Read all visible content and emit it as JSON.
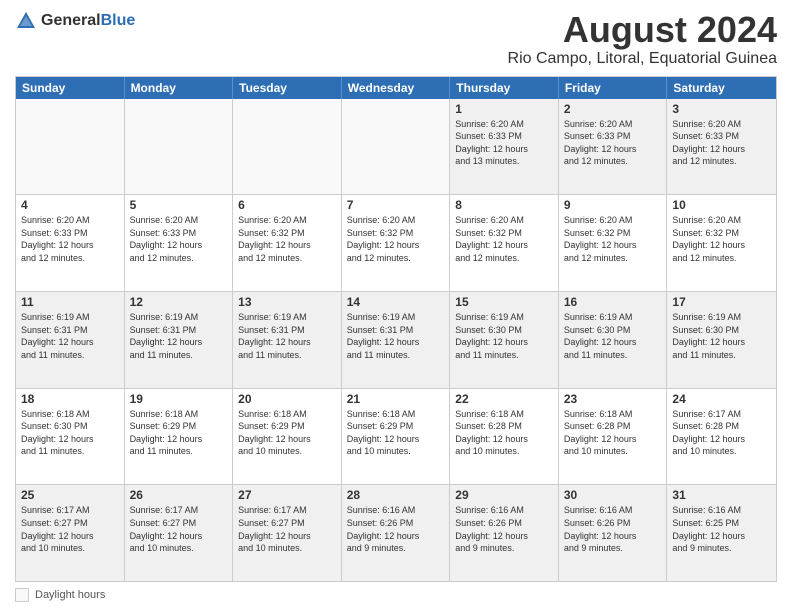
{
  "logo": {
    "general": "General",
    "blue": "Blue"
  },
  "title": "August 2024",
  "subtitle": "Rio Campo, Litoral, Equatorial Guinea",
  "days": [
    "Sunday",
    "Monday",
    "Tuesday",
    "Wednesday",
    "Thursday",
    "Friday",
    "Saturday"
  ],
  "weeks": [
    [
      {
        "day": "",
        "info": ""
      },
      {
        "day": "",
        "info": ""
      },
      {
        "day": "",
        "info": ""
      },
      {
        "day": "",
        "info": ""
      },
      {
        "day": "1",
        "info": "Sunrise: 6:20 AM\nSunset: 6:33 PM\nDaylight: 12 hours\nand 13 minutes."
      },
      {
        "day": "2",
        "info": "Sunrise: 6:20 AM\nSunset: 6:33 PM\nDaylight: 12 hours\nand 12 minutes."
      },
      {
        "day": "3",
        "info": "Sunrise: 6:20 AM\nSunset: 6:33 PM\nDaylight: 12 hours\nand 12 minutes."
      }
    ],
    [
      {
        "day": "4",
        "info": "Sunrise: 6:20 AM\nSunset: 6:33 PM\nDaylight: 12 hours\nand 12 minutes."
      },
      {
        "day": "5",
        "info": "Sunrise: 6:20 AM\nSunset: 6:33 PM\nDaylight: 12 hours\nand 12 minutes."
      },
      {
        "day": "6",
        "info": "Sunrise: 6:20 AM\nSunset: 6:32 PM\nDaylight: 12 hours\nand 12 minutes."
      },
      {
        "day": "7",
        "info": "Sunrise: 6:20 AM\nSunset: 6:32 PM\nDaylight: 12 hours\nand 12 minutes."
      },
      {
        "day": "8",
        "info": "Sunrise: 6:20 AM\nSunset: 6:32 PM\nDaylight: 12 hours\nand 12 minutes."
      },
      {
        "day": "9",
        "info": "Sunrise: 6:20 AM\nSunset: 6:32 PM\nDaylight: 12 hours\nand 12 minutes."
      },
      {
        "day": "10",
        "info": "Sunrise: 6:20 AM\nSunset: 6:32 PM\nDaylight: 12 hours\nand 12 minutes."
      }
    ],
    [
      {
        "day": "11",
        "info": "Sunrise: 6:19 AM\nSunset: 6:31 PM\nDaylight: 12 hours\nand 11 minutes."
      },
      {
        "day": "12",
        "info": "Sunrise: 6:19 AM\nSunset: 6:31 PM\nDaylight: 12 hours\nand 11 minutes."
      },
      {
        "day": "13",
        "info": "Sunrise: 6:19 AM\nSunset: 6:31 PM\nDaylight: 12 hours\nand 11 minutes."
      },
      {
        "day": "14",
        "info": "Sunrise: 6:19 AM\nSunset: 6:31 PM\nDaylight: 12 hours\nand 11 minutes."
      },
      {
        "day": "15",
        "info": "Sunrise: 6:19 AM\nSunset: 6:30 PM\nDaylight: 12 hours\nand 11 minutes."
      },
      {
        "day": "16",
        "info": "Sunrise: 6:19 AM\nSunset: 6:30 PM\nDaylight: 12 hours\nand 11 minutes."
      },
      {
        "day": "17",
        "info": "Sunrise: 6:19 AM\nSunset: 6:30 PM\nDaylight: 12 hours\nand 11 minutes."
      }
    ],
    [
      {
        "day": "18",
        "info": "Sunrise: 6:18 AM\nSunset: 6:30 PM\nDaylight: 12 hours\nand 11 minutes."
      },
      {
        "day": "19",
        "info": "Sunrise: 6:18 AM\nSunset: 6:29 PM\nDaylight: 12 hours\nand 11 minutes."
      },
      {
        "day": "20",
        "info": "Sunrise: 6:18 AM\nSunset: 6:29 PM\nDaylight: 12 hours\nand 10 minutes."
      },
      {
        "day": "21",
        "info": "Sunrise: 6:18 AM\nSunset: 6:29 PM\nDaylight: 12 hours\nand 10 minutes."
      },
      {
        "day": "22",
        "info": "Sunrise: 6:18 AM\nSunset: 6:28 PM\nDaylight: 12 hours\nand 10 minutes."
      },
      {
        "day": "23",
        "info": "Sunrise: 6:18 AM\nSunset: 6:28 PM\nDaylight: 12 hours\nand 10 minutes."
      },
      {
        "day": "24",
        "info": "Sunrise: 6:17 AM\nSunset: 6:28 PM\nDaylight: 12 hours\nand 10 minutes."
      }
    ],
    [
      {
        "day": "25",
        "info": "Sunrise: 6:17 AM\nSunset: 6:27 PM\nDaylight: 12 hours\nand 10 minutes."
      },
      {
        "day": "26",
        "info": "Sunrise: 6:17 AM\nSunset: 6:27 PM\nDaylight: 12 hours\nand 10 minutes."
      },
      {
        "day": "27",
        "info": "Sunrise: 6:17 AM\nSunset: 6:27 PM\nDaylight: 12 hours\nand 10 minutes."
      },
      {
        "day": "28",
        "info": "Sunrise: 6:16 AM\nSunset: 6:26 PM\nDaylight: 12 hours\nand 9 minutes."
      },
      {
        "day": "29",
        "info": "Sunrise: 6:16 AM\nSunset: 6:26 PM\nDaylight: 12 hours\nand 9 minutes."
      },
      {
        "day": "30",
        "info": "Sunrise: 6:16 AM\nSunset: 6:26 PM\nDaylight: 12 hours\nand 9 minutes."
      },
      {
        "day": "31",
        "info": "Sunrise: 6:16 AM\nSunset: 6:25 PM\nDaylight: 12 hours\nand 9 minutes."
      }
    ]
  ],
  "footer": {
    "legend_label": "Daylight hours"
  }
}
